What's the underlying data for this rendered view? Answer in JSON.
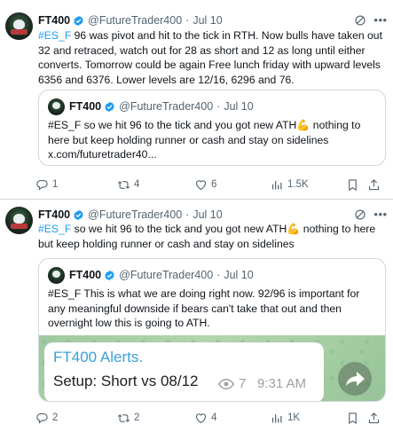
{
  "tweets": [
    {
      "author": {
        "name": "FT400",
        "handle": "@FutureTrader400"
      },
      "date": "Jul 10",
      "hashtag": "#ES_F",
      "text": " 96 was pivot and hit to the tick in RTH.  Now bulls have taken out 32 and retraced, watch out for 28 as short and 12 as long until either converts.  Tomorrow could be again Free lunch friday with upward levels 6356 and 6376.  Lower levels are 12/16, 6296 and 76.",
      "quote": {
        "author": {
          "name": "FT400",
          "handle": "@FutureTrader400"
        },
        "date": "Jul 10",
        "hashtag": "#ES_F",
        "text": " so we hit 96 to the tick and you got new ATH💪 nothing to here but keep holding runner or cash and stay on sidelines",
        "link": "x.com/futuretrader40..."
      },
      "stats": {
        "replies": "1",
        "reposts": "4",
        "likes": "6",
        "views": "1.5K"
      }
    },
    {
      "author": {
        "name": "FT400",
        "handle": "@FutureTrader400"
      },
      "date": "Jul 10",
      "hashtag": "#ES_F",
      "text": " so we hit 96 to the tick and you got new ATH💪 nothing to here but keep holding runner or cash and stay on sidelines",
      "quote": {
        "author": {
          "name": "FT400",
          "handle": "@FutureTrader400"
        },
        "date": "Jul 10",
        "hashtag": "#ES_F",
        "text": " This is what we are doing right now.  92/96 is important for any meaningful downside if bears can't take that out and then overnight low this is going to ATH.",
        "media": {
          "title": "FT400 Alerts.",
          "setup": "Setup: Short vs 08/12",
          "views": "7",
          "time": "9:31 AM"
        }
      },
      "stats": {
        "replies": "2",
        "reposts": "2",
        "likes": "4",
        "views": "1K"
      }
    }
  ],
  "separator": "·",
  "colors": {
    "accent": "#1d9bf0",
    "text": "#0f1419",
    "muted": "#536471",
    "border": "#cfd9de",
    "alert_title": "#3aa0d8"
  },
  "icons": [
    "verified-badge-icon",
    "grok-icon",
    "more-icon",
    "reply-icon",
    "repost-icon",
    "like-icon",
    "views-icon",
    "bookmark-icon",
    "share-icon",
    "eye-icon",
    "forward-icon"
  ]
}
